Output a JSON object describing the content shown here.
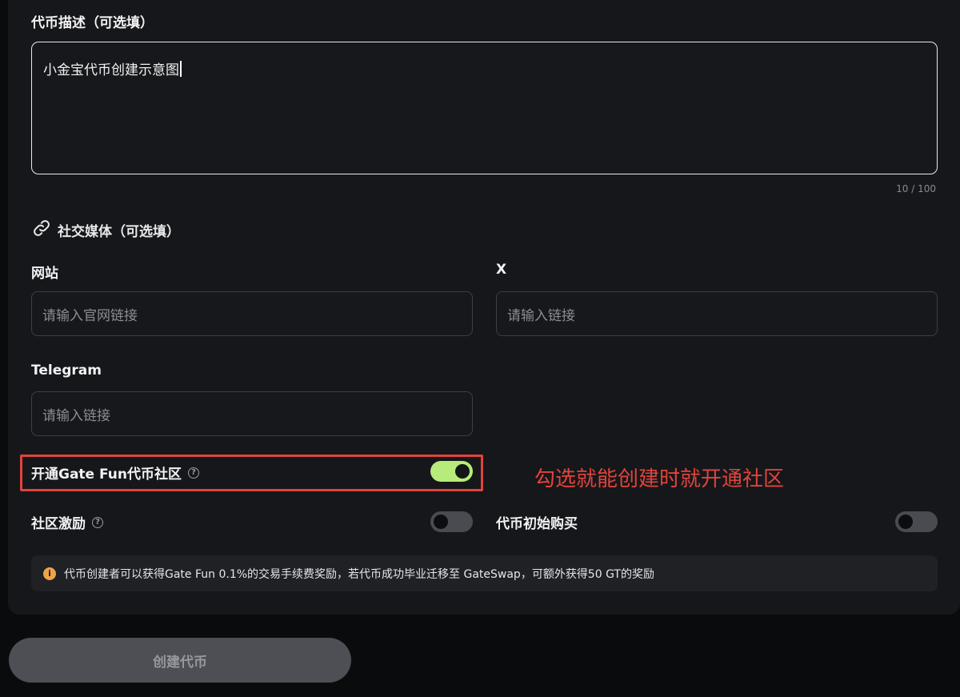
{
  "description": {
    "label": "代币描述（可选填）",
    "value": "小金宝代币创建示意图",
    "counter": "10 / 100"
  },
  "social": {
    "heading": "社交媒体（可选填）",
    "icon": "link-icon",
    "website": {
      "label": "网站",
      "placeholder": "请输入官网链接"
    },
    "x": {
      "label": "X",
      "placeholder": "请输入链接"
    },
    "telegram": {
      "label": "Telegram",
      "placeholder": "请输入链接"
    }
  },
  "toggles": {
    "community": {
      "label": "开通Gate Fun代币社区",
      "on": true
    },
    "incentive": {
      "label": "社区激励",
      "on": false
    },
    "initial_buy": {
      "label": "代币初始购买",
      "on": false
    }
  },
  "annotation": "勾选就能创建时就开通社区",
  "notice": {
    "icon": "info-icon",
    "text": "代币创建者可以获得Gate Fun 0.1%的交易手续费奖励，若代币成功毕业迁移至 GateSwap，可额外获得50 GT的奖励"
  },
  "create_button": "创建代币",
  "colors": {
    "toggle_on": "#b7eb7a",
    "annotation_red": "#e0443c",
    "info_orange": "#eda447"
  }
}
